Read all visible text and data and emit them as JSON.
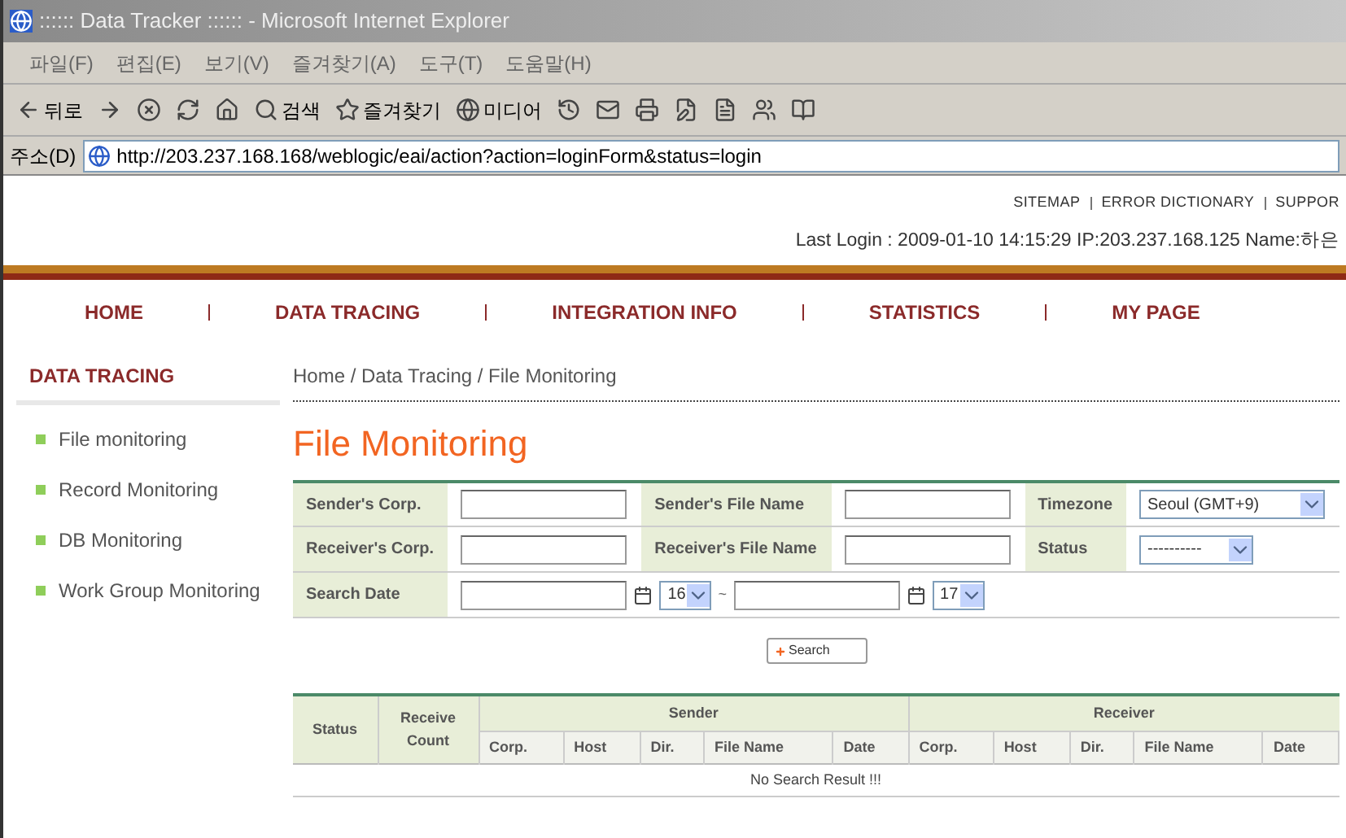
{
  "window": {
    "title": ":::::: Data Tracker :::::: - Microsoft Internet Explorer"
  },
  "menu": [
    "파일(F)",
    "편집(E)",
    "보기(V)",
    "즐겨찾기(A)",
    "도구(T)",
    "도움말(H)"
  ],
  "toolbar": [
    {
      "kind": "back",
      "label": "뒤로"
    },
    {
      "kind": "forward"
    },
    {
      "kind": "stop"
    },
    {
      "kind": "refresh"
    },
    {
      "kind": "home"
    },
    {
      "kind": "search",
      "label": "검색"
    },
    {
      "kind": "favorites",
      "label": "즐겨찾기"
    },
    {
      "kind": "media",
      "label": "미디어"
    },
    {
      "kind": "history"
    },
    {
      "kind": "mail"
    },
    {
      "kind": "print"
    },
    {
      "kind": "edit"
    },
    {
      "kind": "discuss"
    },
    {
      "kind": "messenger"
    },
    {
      "kind": "research"
    }
  ],
  "address": {
    "label": "주소(D)",
    "url": "http://203.237.168.168/weblogic/eai/action?action=loginForm&status=login"
  },
  "top_links": [
    "SITEMAP",
    "ERROR DICTIONARY",
    "SUPPOR"
  ],
  "last_login": "Last Login : 2009-01-10 14:15:29 IP:203.237.168.125 Name:하은",
  "nav": [
    "HOME",
    "DATA TRACING",
    "INTEGRATION INFO",
    "STATISTICS",
    "MY PAGE"
  ],
  "sidebar": {
    "title": "DATA TRACING",
    "items": [
      "File monitoring",
      "Record Monitoring",
      "DB Monitoring",
      "Work Group Monitoring"
    ]
  },
  "breadcrumb": "Home / Data Tracing / File Monitoring",
  "heading": "File Monitoring",
  "form": {
    "sender_corp": "Sender's Corp.",
    "sender_file": "Sender's File Name",
    "timezone": {
      "label": "Timezone",
      "value": "Seoul (GMT+9)"
    },
    "receiver_corp": "Receiver's Corp.",
    "receiver_file": "Receiver's File Name",
    "status": {
      "label": "Status",
      "value": "----------"
    },
    "search_date": {
      "label": "Search Date",
      "from_hour": "16",
      "separator": "~",
      "to_hour": "17"
    }
  },
  "search_button": "Search",
  "table": {
    "status": "Status",
    "receive_count": "Receive Count",
    "sender": "Sender",
    "receiver": "Receiver",
    "sender_columns": [
      "Corp.",
      "Host",
      "Dir.",
      "File Name",
      "Date"
    ],
    "receiver_columns": [
      "Corp.",
      "Host",
      "Dir.",
      "File Name",
      "Date"
    ],
    "empty": "No Search Result !!!"
  }
}
